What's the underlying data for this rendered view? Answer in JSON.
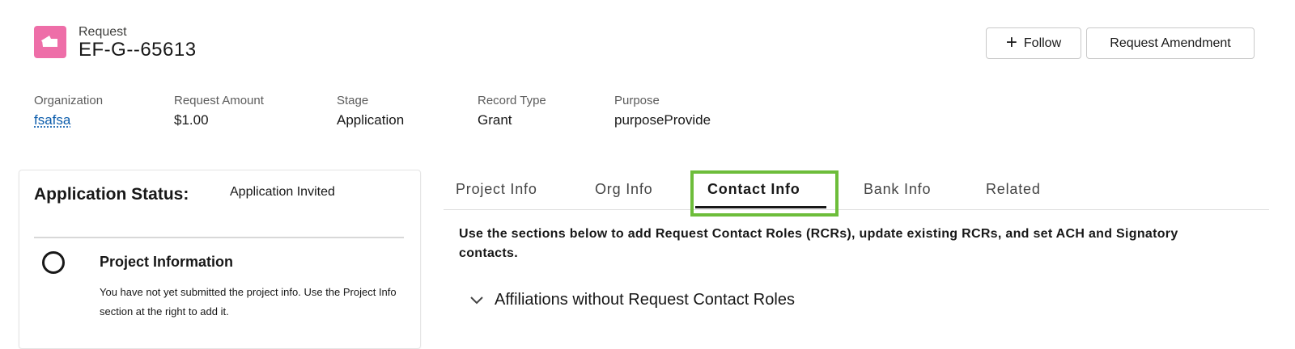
{
  "header": {
    "icon": "request-icon",
    "icon_color": "#ee6ea8",
    "object_type": "Request",
    "record_name": "EF-G--65613",
    "follow_label": "Follow",
    "amend_label": "Request Amendment"
  },
  "highlights": [
    {
      "label": "Organization",
      "value": "fsafsa"
    },
    {
      "label": "Request Amount",
      "value": "$1.00"
    },
    {
      "label": "Stage",
      "value": "Application"
    },
    {
      "label": "Record Type",
      "value": "Grant"
    },
    {
      "label": "Purpose",
      "value": "purposeProvide"
    }
  ],
  "status_card": {
    "status_label": "Application Status:",
    "status_value": "Application Invited",
    "step_title": "Project Information",
    "step_description": "You have not yet submitted the project info. Use the Project Info section at the right to add it."
  },
  "tabs": [
    {
      "label": "Project Info"
    },
    {
      "label": "Org Info"
    },
    {
      "label": "Contact Info",
      "active": true
    },
    {
      "label": "Bank Info"
    },
    {
      "label": "Related"
    }
  ],
  "highlight_color": "#6dbd3a",
  "content": {
    "instructions": "Use the sections below to add Request Contact Roles (RCRs), update existing RCRs, and set ACH and Signatory contacts.",
    "section_title": "Affiliations without Request Contact Roles"
  }
}
